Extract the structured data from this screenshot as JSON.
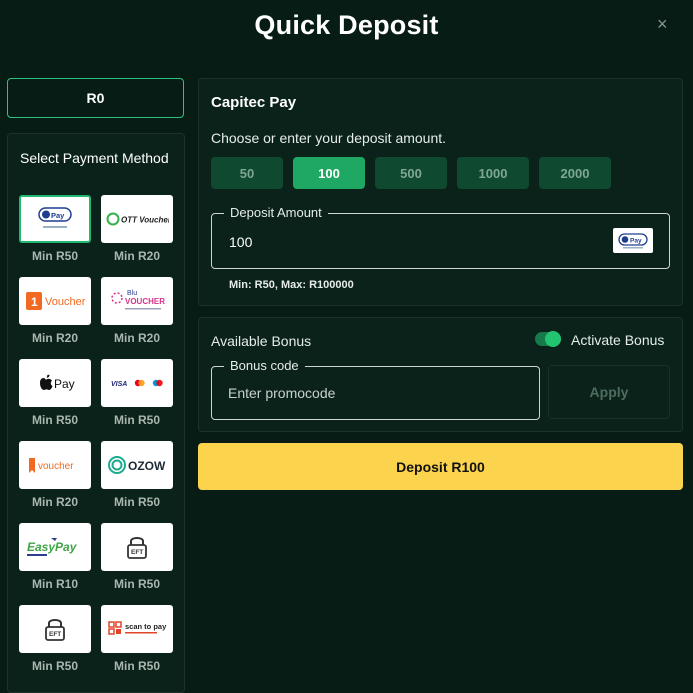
{
  "modal": {
    "title": "Quick Deposit",
    "close_icon": "×"
  },
  "balance": {
    "label": "R0"
  },
  "payment_methods": {
    "title": "Select Payment Method",
    "items": [
      {
        "name": "Capitec Pay",
        "logo": "Pay",
        "min": "Min R50",
        "selected": true
      },
      {
        "name": "OTT Voucher",
        "logo": "OTT Voucher",
        "min": "Min R20"
      },
      {
        "name": "1Voucher",
        "logo": "Voucher",
        "min": "Min R20"
      },
      {
        "name": "Blu Voucher",
        "logo": "VOUCHER",
        "min": "Min R20"
      },
      {
        "name": "Apple Pay",
        "logo": "Pay",
        "min": "Min R50"
      },
      {
        "name": "Cards",
        "logo": "VISA",
        "min": "Min R50"
      },
      {
        "name": "1Voucher",
        "logo": "voucher",
        "min": "Min R20"
      },
      {
        "name": "Ozow",
        "logo": "OZOW",
        "min": "Min R50"
      },
      {
        "name": "EasyPay",
        "logo": "EasyPay",
        "min": "Min R10"
      },
      {
        "name": "EFT Secure",
        "logo": "EFT",
        "min": "Min R50"
      },
      {
        "name": "EFT Secure",
        "logo": "EFT",
        "min": "Min R50"
      },
      {
        "name": "Scan to Pay",
        "logo": "scan to pay",
        "min": "Min R50"
      }
    ]
  },
  "deposit": {
    "method_title": "Capitec Pay",
    "prompt": "Choose or enter your deposit amount.",
    "amounts": [
      "50",
      "100",
      "500",
      "1000",
      "2000"
    ],
    "selected_amount": "100",
    "amount_label": "Deposit Amount",
    "amount_value": "100",
    "limits": "Min: R50, Max: R100000"
  },
  "bonus": {
    "title": "Available Bonus",
    "toggle_label": "Activate Bonus",
    "toggle_on": true,
    "code_label": "Bonus code",
    "code_placeholder": "Enter promocode",
    "apply_label": "Apply"
  },
  "submit": {
    "label": "Deposit R100"
  },
  "colors": {
    "background": "#071c14",
    "panel": "#0a2219",
    "accent_green": "#1fa864",
    "amount_button": "#0f4a30",
    "deposit_button": "#fcd34d"
  }
}
